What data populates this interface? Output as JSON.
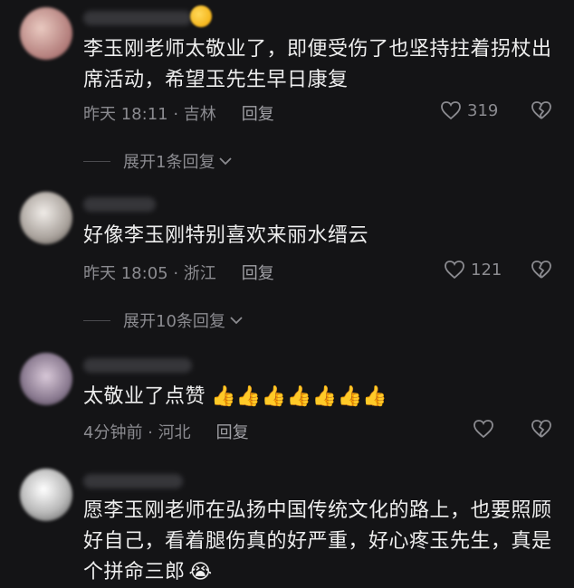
{
  "comments": [
    {
      "text": "李玉刚老师太敬业了，即便受伤了也坚持拄着拐杖出席活动，希望玉先生早日康复",
      "time_location": "昨天 18:11 · 吉林",
      "reply_label": "回复",
      "like_count": "319",
      "expand_label": "展开1条回复"
    },
    {
      "text": "好像李玉刚特别喜欢来丽水缙云",
      "time_location": "昨天 18:05 · 浙江",
      "reply_label": "回复",
      "like_count": "121",
      "expand_label": "展开10条回复"
    },
    {
      "text": "太敬业了点赞",
      "emoji": "👍👍👍👍👍👍👍",
      "time_location": "4分钟前 · 河北",
      "reply_label": "回复",
      "like_count": ""
    },
    {
      "text": "愿李玉刚老师在弘扬中国传统文化的路上，也要照顾好自己，看着腿伤真的好严重，好心疼玉先生，真是个拼命三郎",
      "emoji": "😭"
    }
  ],
  "icons": {
    "like": "heart-icon",
    "dislike": "broken-heart-icon",
    "expand": "chevron-down-icon"
  }
}
